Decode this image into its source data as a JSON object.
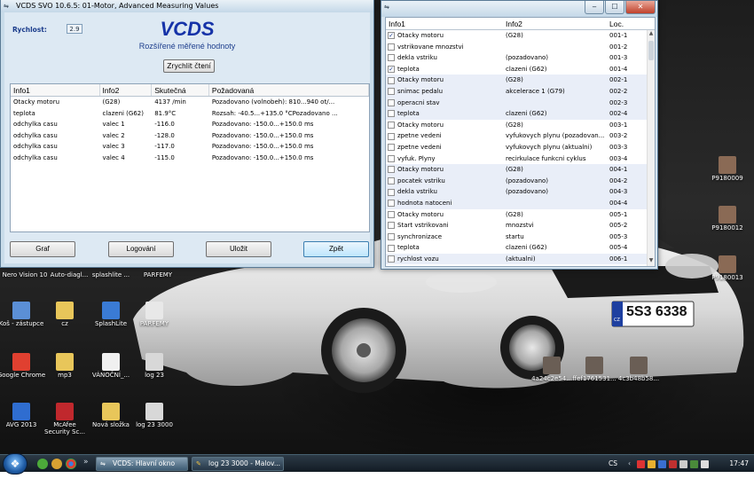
{
  "vcds_window": {
    "title": "VCDS SVO 10.6.5: 01-Motor,  Advanced Measuring Values",
    "speed_label": "Rychlost:",
    "speed_value": "2.9",
    "logo": "VCDS",
    "subtitle": "Rozšířené měřené hodnoty",
    "speed_up_button": "Zrychlit čtení",
    "columns": [
      "Info1",
      "Info2",
      "Skutečná",
      "Požadovaná"
    ],
    "rows": [
      [
        "Otacky motoru",
        "(G28)",
        "4137 /min",
        "Pozadovano (volnobeh): 810...940 ot/..."
      ],
      [
        "teplota",
        "clazeni (G62)",
        "81.9°C",
        "Rozsah: -40.5...+135.0 °CPozadovano ..."
      ],
      [
        "odchylka casu",
        "valec 1",
        "-116.0",
        "Pozadovano: -150.0...+150.0 ms"
      ],
      [
        "odchylka casu",
        "valec 2",
        "-128.0",
        "Pozadovano: -150.0...+150.0 ms"
      ],
      [
        "odchylka casu",
        "valec 3",
        "-117.0",
        "Pozadovano: -150.0...+150.0 ms"
      ],
      [
        "odchylka casu",
        "valec 4",
        "-115.0",
        "Pozadovano: -150.0...+150.0 ms"
      ]
    ],
    "buttons": {
      "graph": "Graf",
      "logging": "Logování",
      "save": "Uložit",
      "back": "Zpět"
    }
  },
  "list_window": {
    "columns": [
      "Info1",
      "Info2",
      "Loc."
    ],
    "rows": [
      {
        "checked": true,
        "info1": "Otacky motoru",
        "info2": "(G28)",
        "loc": "001-1"
      },
      {
        "checked": false,
        "info1": "vstrikovane mnozstvi",
        "info2": "",
        "loc": "001-2"
      },
      {
        "checked": false,
        "info1": "dekla vstriku",
        "info2": "(pozadovano)",
        "loc": "001-3"
      },
      {
        "checked": true,
        "info1": "teplota",
        "info2": "clazeni (G62)",
        "loc": "001-4"
      },
      {
        "checked": false,
        "info1": "Otacky motoru",
        "info2": "(G28)",
        "loc": "002-1"
      },
      {
        "checked": false,
        "info1": "snimac pedalu",
        "info2": "akcelerace 1 (G79)",
        "loc": "002-2"
      },
      {
        "checked": false,
        "info1": "operacni stav",
        "info2": "",
        "loc": "002-3"
      },
      {
        "checked": false,
        "info1": "teplota",
        "info2": "clazeni (G62)",
        "loc": "002-4"
      },
      {
        "checked": false,
        "info1": "Otacky motoru",
        "info2": "(G28)",
        "loc": "003-1"
      },
      {
        "checked": false,
        "info1": "zpetne vedeni",
        "info2": "vyfukovych plynu (pozadovan...",
        "loc": "003-2"
      },
      {
        "checked": false,
        "info1": "zpetne vedeni",
        "info2": "vyfukovych plynu (aktualni)",
        "loc": "003-3"
      },
      {
        "checked": false,
        "info1": "vyfuk. Plyny",
        "info2": "recirkulace funkcni cyklus",
        "loc": "003-4"
      },
      {
        "checked": false,
        "info1": "Otacky motoru",
        "info2": "(G28)",
        "loc": "004-1"
      },
      {
        "checked": false,
        "info1": "pocatek vstriku",
        "info2": "(pozadovano)",
        "loc": "004-2"
      },
      {
        "checked": false,
        "info1": "dekla vstriku",
        "info2": "(pozadovano)",
        "loc": "004-3"
      },
      {
        "checked": false,
        "info1": "hodnota natoceni",
        "info2": "",
        "loc": "004-4"
      },
      {
        "checked": false,
        "info1": "Otacky motoru",
        "info2": "(G28)",
        "loc": "005-1"
      },
      {
        "checked": false,
        "info1": "Start vstrikovani",
        "info2": "mnozstvi",
        "loc": "005-2"
      },
      {
        "checked": false,
        "info1": "synchronizace",
        "info2": "startu",
        "loc": "005-3"
      },
      {
        "checked": false,
        "info1": "teplota",
        "info2": "clazeni (G62)",
        "loc": "005-4"
      },
      {
        "checked": false,
        "info1": "rychlost vozu",
        "info2": "(aktualni)",
        "loc": "006-1"
      }
    ]
  },
  "desktop": {
    "top_labels": [
      "Nero Vision 10",
      "Auto-diagl...",
      "splashlite ...",
      "PARFEMY"
    ],
    "icons_left": [
      {
        "label": "Koš - zástupce",
        "icon": "recycle-bin-icon",
        "color": "#5b8fd6"
      },
      {
        "label": "cz",
        "icon": "folder-icon",
        "color": "#e8c65a"
      },
      {
        "label": "SplashLite",
        "icon": "splashlite-icon",
        "color": "#3a7bd5"
      },
      {
        "label": "PARFEMY",
        "icon": "text-file-icon",
        "color": "#e8e8e8"
      },
      {
        "label": "Google Chrome",
        "icon": "chrome-icon",
        "color": "#e04030"
      },
      {
        "label": "mp3",
        "icon": "folder-icon",
        "color": "#e8c65a"
      },
      {
        "label": "VÁNOČNÍ_...",
        "icon": "document-icon",
        "color": "#f0f0f0"
      },
      {
        "label": "log 23",
        "icon": "log-file-icon",
        "color": "#d8d8d8"
      },
      {
        "label": "AVG 2013",
        "icon": "avg-icon",
        "color": "#2f6dd0"
      },
      {
        "label": "McAfee Security Sc...",
        "icon": "mcafee-icon",
        "color": "#c0282d"
      },
      {
        "label": "Nová složka",
        "icon": "folder-icon",
        "color": "#e8c65a"
      },
      {
        "label": "log 23 3000",
        "icon": "log-file-icon",
        "color": "#d8d8d8"
      }
    ],
    "icons_mid": [
      {
        "label": "4a24c2e54...",
        "icon": "photo-icon"
      },
      {
        "label": "ffef1761531...",
        "icon": "photo-icon"
      },
      {
        "label": "4c3b48b58...",
        "icon": "photo-icon"
      }
    ],
    "icons_right": [
      {
        "label": "P9180009",
        "icon": "photo-icon"
      },
      {
        "label": "P9180012",
        "icon": "photo-icon"
      },
      {
        "label": "P9180013",
        "icon": "photo-icon"
      }
    ],
    "license_plate": "5S3 6338",
    "plate_country": "CZ"
  },
  "taskbar": {
    "tasks": [
      "VCDS:  Hlavní okno",
      "log 23 3000 - Malov..."
    ],
    "language": "CS",
    "time": "17:47"
  }
}
